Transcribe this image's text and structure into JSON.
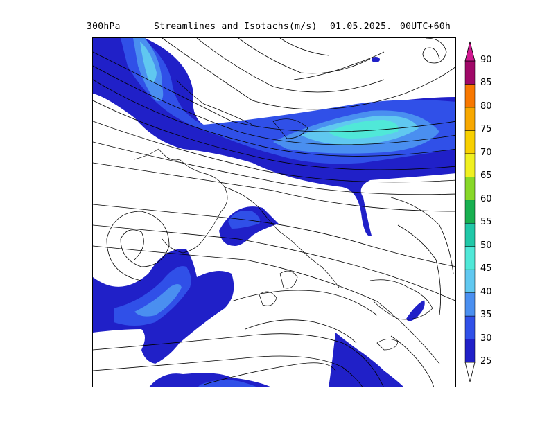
{
  "header": {
    "level": "300hPa",
    "product": "Streamlines and Isotachs(m/s)",
    "date": "01.05.2025.",
    "run": "00UTC+60h"
  },
  "colorbar": {
    "levels": [
      "25",
      "30",
      "35",
      "40",
      "45",
      "50",
      "55",
      "60",
      "65",
      "70",
      "75",
      "80",
      "85",
      "90"
    ],
    "colors": [
      "#2020c8",
      "#3050e8",
      "#4a8ff0",
      "#60c8f0",
      "#50e8d8",
      "#20c8a8",
      "#18b050",
      "#88d828",
      "#f0f020",
      "#f8d000",
      "#f8a800",
      "#f87800",
      "#a00868",
      "#d01890"
    ]
  }
}
